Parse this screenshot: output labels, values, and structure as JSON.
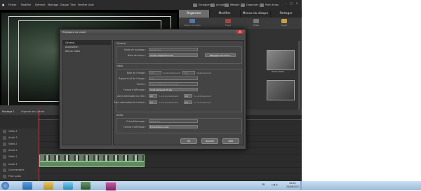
{
  "app": {
    "menu": [
      "Fichier",
      "Modifier",
      "Elément",
      "Montage",
      "Disque",
      "Titre",
      "Fenêtre",
      "Aide"
    ],
    "toolbar": [
      "Enregistrer",
      "Annuler",
      "Rétablir",
      "Organiser",
      "Plein écran"
    ],
    "tabs": [
      "Organiser",
      "Modifier",
      "Menus du disque",
      "Partager"
    ],
    "subtabs": [
      "Obtenir le média",
      "Projet",
      "Effets",
      "Projet"
    ],
    "project_dropdown": "Liste des"
  },
  "monitor": {
    "bottom_labels": [
      "Montage 1",
      "Légende des scènes"
    ]
  },
  "media": {
    "thumb_label": "MOV01.MOD"
  },
  "timeline": {
    "header": [
      "Montage 1",
      "Légende des scènes"
    ],
    "tracks": [
      "Vidéo 3",
      "Audio 3",
      "Vidéo 2",
      "Audio 2",
      "Vidéo 1",
      "Audio 1",
      "Commentaire",
      "Piste audio"
    ]
  },
  "dialog": {
    "title": "Réglages du projet",
    "close_label": "X",
    "nav": [
      "Général",
      "Acquisition",
      "Rendu vidéo"
    ],
    "section_general": "Général",
    "mode_label": "Mode de montage :",
    "mode_value": "Générique",
    "timebase_label": "Base de temps :",
    "timebase_value": "25,00 images/seconde",
    "playback_btn": "Réglages de lecture...",
    "video_label": "Vidéo",
    "framesize_label": "Taille de l'image :",
    "framesize_w": "720",
    "framesize_h_label": "horizontalement",
    "framesize_v": "576",
    "framesize_v_label": "verticalement",
    "aspect_label": "Rapport L/H de l'image :",
    "aspect_value": "4:3",
    "field_label": "Trames :",
    "field_value": "Trame inférieure en premier",
    "display_label": "Format d'affichage :",
    "display_value": "Code temporel 25 ips",
    "title_safe_label": "Zone admissible du titre :",
    "title_safe_h": "20",
    "title_safe_h_unit": "% horizontalement",
    "title_safe_v": "20",
    "title_safe_v_unit": "% verticalement",
    "action_safe_label": "Zone admissible de l'action :",
    "action_safe_h": "10",
    "action_safe_h_unit": "% horizontalement",
    "action_safe_v": "10",
    "action_safe_v_unit": "% verticalement",
    "audio_label": "Audio",
    "samplerate_label": "Echantillonnage :",
    "samplerate_value": "48000 Hz",
    "audio_display_label": "Format d'affichage :",
    "audio_display_value": "Echantillons audio",
    "ok": "OK",
    "cancel": "Annuler",
    "help": "Aide"
  },
  "taskbar": {
    "lang": "FR",
    "time": "10:00",
    "date": "25/06/2011"
  }
}
